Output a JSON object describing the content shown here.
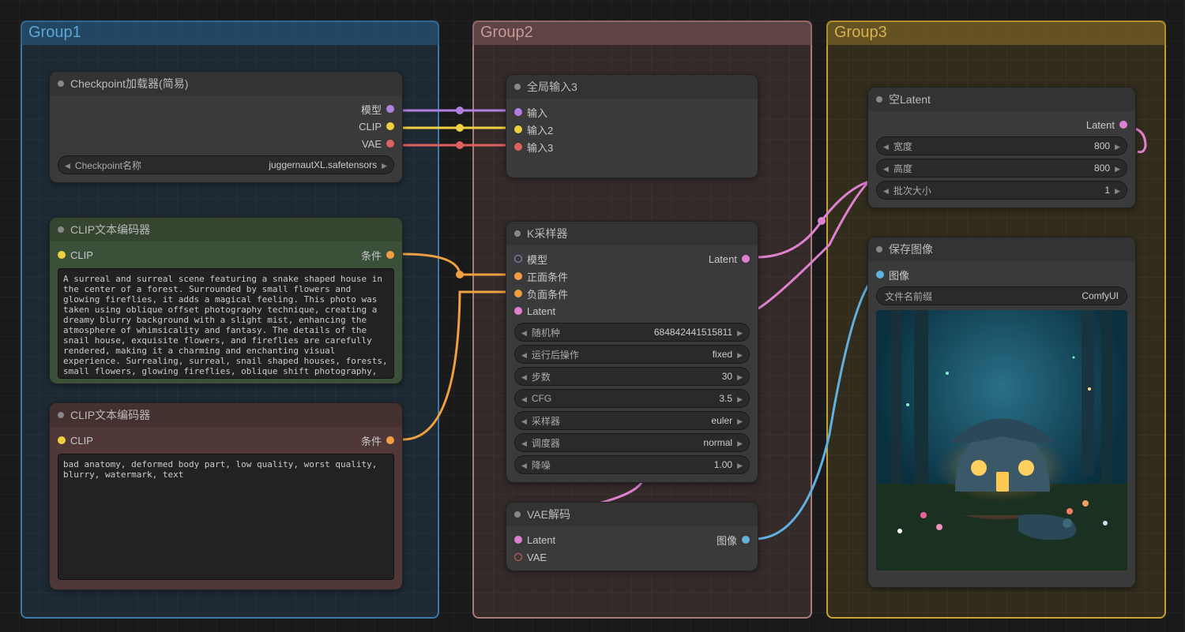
{
  "groups": {
    "g1": "Group1",
    "g2": "Group2",
    "g3": "Group3"
  },
  "nodes": {
    "checkpoint": {
      "title": "Checkpoint加载器(简易)",
      "outputs": {
        "model": "模型",
        "clip": "CLIP",
        "vae": "VAE"
      },
      "widget": {
        "label": "Checkpoint名称",
        "value": "juggernautXL.safetensors"
      }
    },
    "clip_pos": {
      "title": "CLIP文本编码器",
      "input": "CLIP",
      "output": "条件",
      "text": "A surreal and surreal scene featuring a snake shaped house in the center of a forest. Surrounded by small flowers and glowing fireflies, it adds a magical feeling. This photo was taken using oblique offset photography technique, creating a dreamy blurry background with a slight mist, enhancing the atmosphere of whimsicality and fantasy. The details of the snail house, exquisite flowers, and fireflies are carefully rendered, making it a charming and enchanting visual experience. Surrealing, surreal, snail shaped houses, forests, small flowers, glowing fireflies, oblique shift photography, dreamy, blurry backgrounds, light mist,"
    },
    "clip_neg": {
      "title": "CLIP文本编码器",
      "input": "CLIP",
      "output": "条件",
      "text": "bad anatomy, deformed body part, low quality, worst quality, blurry, watermark, text"
    },
    "global_input": {
      "title": "全局输入3",
      "inputs": {
        "in1": "输入",
        "in2": "输入2",
        "in3": "输入3"
      }
    },
    "ksampler": {
      "title": "K采样器",
      "inputs": {
        "model": "模型",
        "positive": "正面条件",
        "negative": "负面条件",
        "latent": "Latent"
      },
      "output": "Latent",
      "widgets": [
        {
          "label": "随机种",
          "value": "684842441515811"
        },
        {
          "label": "运行后操作",
          "value": "fixed"
        },
        {
          "label": "步数",
          "value": "30"
        },
        {
          "label": "CFG",
          "value": "3.5"
        },
        {
          "label": "采样器",
          "value": "euler"
        },
        {
          "label": "调度器",
          "value": "normal"
        },
        {
          "label": "降噪",
          "value": "1.00"
        }
      ]
    },
    "vae_decode": {
      "title": "VAE解码",
      "inputs": {
        "latent": "Latent",
        "vae": "VAE"
      },
      "output": "图像"
    },
    "empty_latent": {
      "title": "空Latent",
      "output": "Latent",
      "widgets": [
        {
          "label": "宽度",
          "value": "800"
        },
        {
          "label": "高度",
          "value": "800"
        },
        {
          "label": "批次大小",
          "value": "1"
        }
      ]
    },
    "save_image": {
      "title": "保存图像",
      "input": "图像",
      "widget": {
        "label": "文件名前缀",
        "value": "ComfyUI"
      }
    }
  }
}
